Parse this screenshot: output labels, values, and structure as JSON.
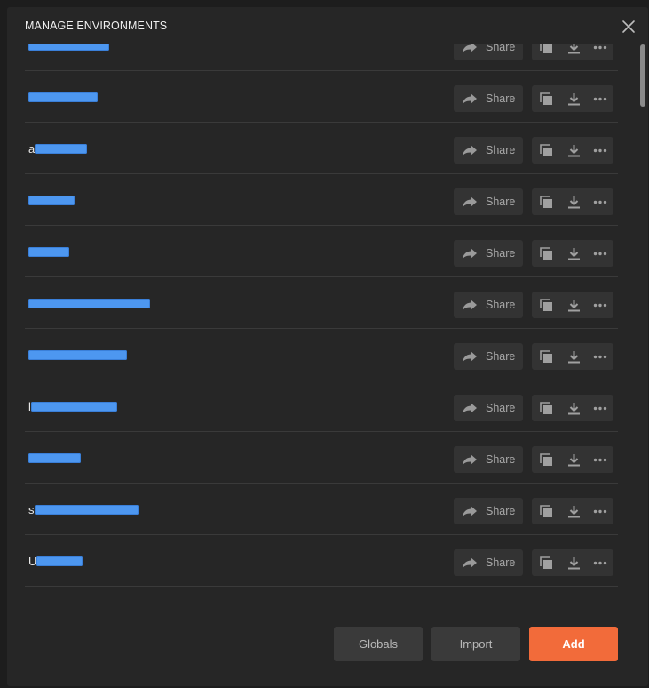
{
  "modal": {
    "title": "MANAGE ENVIRONMENTS",
    "close_icon": "close-icon"
  },
  "share_label": "Share",
  "environments": [
    {
      "prefix": "",
      "redacted_chars": 14
    },
    {
      "prefix": "",
      "redacted_chars": 12
    },
    {
      "prefix": "a",
      "redacted_chars": 9
    },
    {
      "prefix": "",
      "redacted_chars": 8
    },
    {
      "prefix": "",
      "redacted_chars": 7
    },
    {
      "prefix": "",
      "redacted_chars": 21
    },
    {
      "prefix": "",
      "redacted_chars": 17
    },
    {
      "prefix": "l",
      "redacted_chars": 15
    },
    {
      "prefix": "",
      "redacted_chars": 9
    },
    {
      "prefix": "s",
      "redacted_chars": 18
    },
    {
      "prefix": "U",
      "redacted_chars": 8
    }
  ],
  "row_actions": {
    "share_icon": "share-arrow-icon",
    "duplicate_icon": "duplicate-icon",
    "download_icon": "download-icon",
    "more_icon": "more-dots-icon"
  },
  "footer": {
    "globals_label": "Globals",
    "import_label": "Import",
    "add_label": "Add"
  },
  "colors": {
    "accent": "#f26b3a",
    "redaction": "#4d97f0"
  }
}
